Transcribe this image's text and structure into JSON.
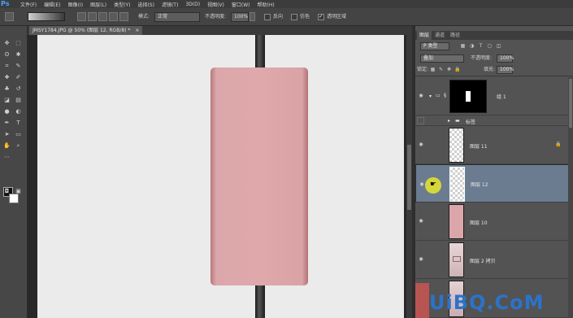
{
  "app": {
    "logo": "Ps"
  },
  "menu": [
    "文件(F)",
    "编辑(E)",
    "图像(I)",
    "图层(L)",
    "类型(Y)",
    "选择(S)",
    "滤镜(T)",
    "3D(D)",
    "视图(V)",
    "窗口(W)",
    "帮助(H)"
  ],
  "options": {
    "mode_label": "模式:",
    "mode_value": "正常",
    "opacity_label": "不透明度:",
    "opacity_value": "100%",
    "reverse_label": "反向",
    "dither_label": "仿色",
    "transparency_label": "透明区域",
    "transparency_checked": true
  },
  "document": {
    "tab_title": "JMSY1784.JPG @ 50% (图层 12, RGB/8) *",
    "close_glyph": "×"
  },
  "layers_panel": {
    "tabs": [
      "图层",
      "通道",
      "路径"
    ],
    "filter_value": "P 类型",
    "blend_value": "叠加",
    "opacity_label": "不透明度:",
    "opacity_value": "100%",
    "lock_label": "锁定:",
    "fill_label": "填充:",
    "fill_value": "100%",
    "layers": [
      {
        "name": "组 1",
        "visible": true,
        "kind": "group",
        "selected": false
      },
      {
        "name": "标签",
        "visible": false,
        "kind": "folder",
        "selected": false
      },
      {
        "name": "图层 11",
        "visible": true,
        "kind": "layer",
        "selected": false,
        "locked": true
      },
      {
        "name": "图层 12",
        "visible": true,
        "kind": "layer",
        "selected": true
      },
      {
        "name": "图层 10",
        "visible": true,
        "kind": "layer",
        "selected": false
      },
      {
        "name": "图层 2 拷贝",
        "visible": true,
        "kind": "layer",
        "selected": false
      }
    ]
  },
  "colors": {
    "accent_selected": "#6b7c91",
    "pink_box": "#dfa9ac",
    "foreground": "#111111",
    "background": "#ffffff"
  },
  "watermark": "UiBQ.CoM"
}
